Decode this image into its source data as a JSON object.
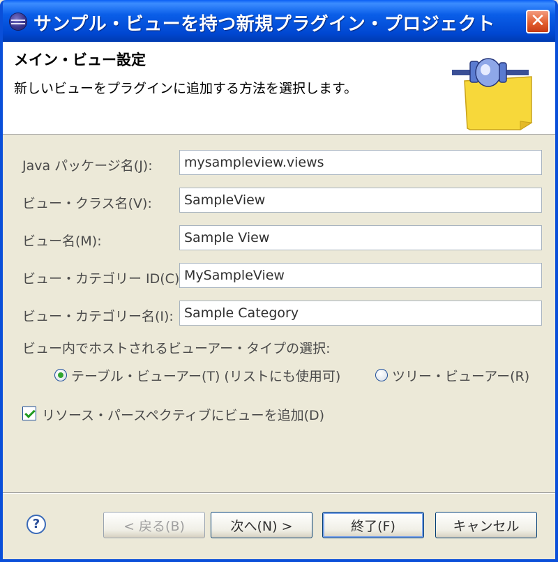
{
  "window": {
    "title": "サンプル・ビューを持つ新規プラグイン・プロジェクト",
    "close_glyph": "✕"
  },
  "header": {
    "title": "メイン・ビュー設定",
    "description": "新しいビューをプラグインに追加する方法を選択します。"
  },
  "fields": [
    {
      "label": "Java パッケージ名(J):",
      "value": "mysampleview.views"
    },
    {
      "label": "ビュー・クラス名(V):",
      "value": "SampleView"
    },
    {
      "label": "ビュー名(M):",
      "value": "Sample View"
    },
    {
      "label": "ビュー・カテゴリー ID(C):",
      "value": "MySampleView"
    },
    {
      "label": "ビュー・カテゴリー名(I):",
      "value": "Sample Category"
    }
  ],
  "viewer_type": {
    "label": "ビュー内でホストされるビューアー・タイプの選択:",
    "options": [
      {
        "label": "テーブル・ビューアー(T) (リストにも使用可)",
        "selected": true
      },
      {
        "label": "ツリー・ビューアー(R)",
        "selected": false
      }
    ]
  },
  "add_to_perspective": {
    "label": "リソース・パースペクティブにビューを追加(D)",
    "checked": true
  },
  "footer": {
    "help_glyph": "?",
    "back_label": "< 戻る(B)",
    "next_label": "次へ(N) >",
    "finish_label": "終了(F)",
    "cancel_label": "キャンセル"
  },
  "colors": {
    "title_bar": "#0a5ee8",
    "dialog_bg": "#ece9d8",
    "radio_dot": "#2fa52f",
    "check_mark": "#1f9a1f"
  }
}
